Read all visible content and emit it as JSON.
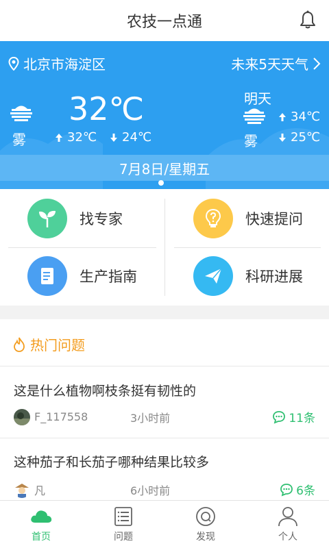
{
  "header": {
    "title": "农技一点通",
    "bell_icon": "bell-icon"
  },
  "weather": {
    "location": "北京市海淀区",
    "forecast_link": "未来5天天气",
    "today": {
      "condition": "雾",
      "temp_now": "32℃",
      "high": "32℃",
      "low": "24℃"
    },
    "tomorrow": {
      "label": "明天",
      "condition": "雾",
      "high": "34℃",
      "low": "25℃"
    },
    "date": "7月8日/星期五"
  },
  "menu": [
    {
      "label": "找专家",
      "color": "#4fd09a",
      "icon": "seedling-icon"
    },
    {
      "label": "快速提问",
      "color": "#fdc94a",
      "icon": "lightbulb-question-icon"
    },
    {
      "label": "生产指南",
      "color": "#4a9ff2",
      "icon": "document-icon"
    },
    {
      "label": "科研进展",
      "color": "#35b9f2",
      "icon": "paper-plane-icon"
    }
  ],
  "hot": {
    "title": "热门问题",
    "questions": [
      {
        "text": "这是什么植物啊枝条挺有韧性的",
        "user": "F_117558",
        "time": "3小时前",
        "count": "11条"
      },
      {
        "text": "这种茄子和长茄子哪种结果比较多",
        "user": "凡",
        "time": "6小时前",
        "count": "6条"
      }
    ]
  },
  "nav": [
    {
      "label": "首页",
      "icon": "home-cloud-icon",
      "active": true
    },
    {
      "label": "问题",
      "icon": "list-icon",
      "active": false
    },
    {
      "label": "发现",
      "icon": "discover-icon",
      "active": false
    },
    {
      "label": "个人",
      "icon": "person-icon",
      "active": false
    }
  ],
  "colors": {
    "accent_green": "#2fbf71",
    "weather_blue": "#2d9ff0",
    "hot_orange": "#f39c1e"
  }
}
